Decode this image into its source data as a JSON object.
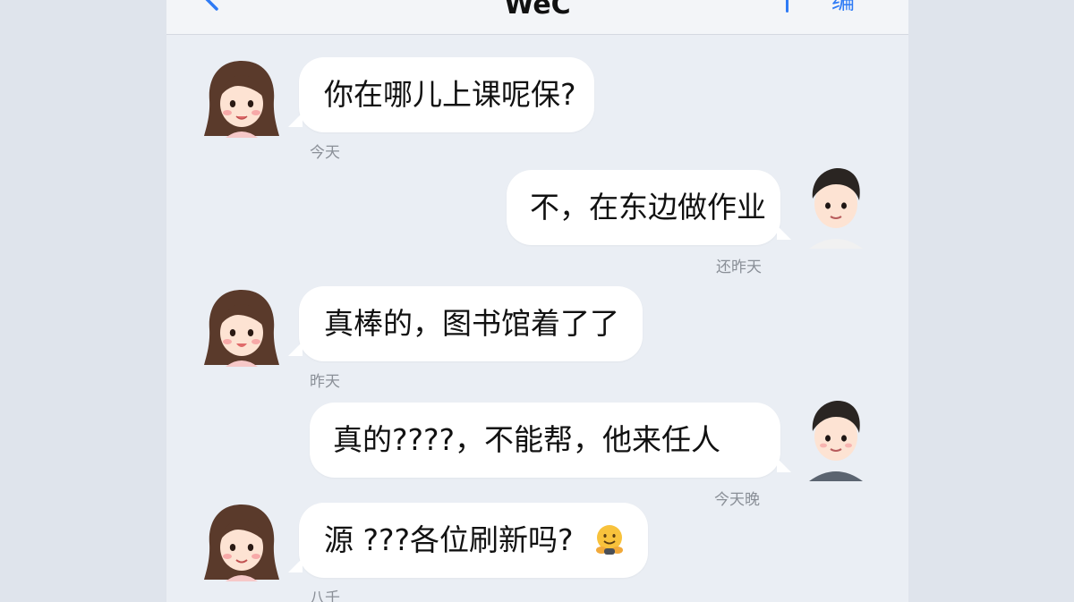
{
  "header": {
    "back_icon": "chevron-left-icon",
    "title": "WeC",
    "action_label": "编"
  },
  "messages": [
    {
      "side": "left",
      "avatar": "girl-avatar",
      "text": "你在哪儿上课呢保?",
      "time": "今天"
    },
    {
      "side": "right",
      "avatar": "boy-avatar",
      "text": "不，在东边做作业",
      "time": "还昨天"
    },
    {
      "side": "left",
      "avatar": "girl-avatar",
      "text": "真棒的，图书馆着了了",
      "time": "昨天"
    },
    {
      "side": "right",
      "avatar": "boy-avatar",
      "text": "真的????，不能帮，他来任人",
      "time": "今天晚"
    },
    {
      "side": "left",
      "avatar": "girl-avatar",
      "text": "源 ???各位刷新吗?",
      "emoji": "hugging-face-icon",
      "time": "八千"
    }
  ],
  "colors": {
    "accent": "#2f7bf5",
    "chat_bg": "#eaeef4",
    "bubble": "#ffffff",
    "timestamp": "#8a8f97"
  }
}
